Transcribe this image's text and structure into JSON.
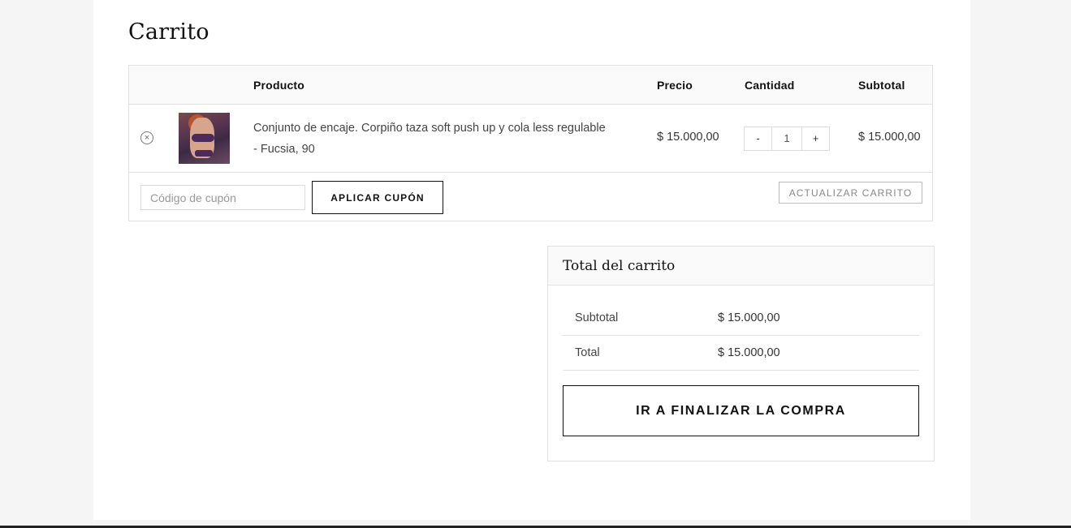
{
  "page_title": "Carrito",
  "table": {
    "headers": {
      "product": "Producto",
      "price": "Precio",
      "quantity": "Cantidad",
      "subtotal": "Subtotal"
    },
    "items": [
      {
        "name": "Conjunto de encaje. Corpiño taza soft push up y cola less regulable - Fucsia, 90",
        "price": "$ 15.000,00",
        "quantity": "1",
        "minus_label": "-",
        "plus_label": "+",
        "subtotal": "$ 15.000,00",
        "remove_icon": "×",
        "thumbnail_icon": "product-photo"
      }
    ]
  },
  "coupon": {
    "placeholder": "Código de cupón",
    "value": "",
    "apply_label": "APLICAR CUPÓN"
  },
  "update_cart_label": "ACTUALIZAR CARRITO",
  "totals": {
    "title": "Total del carrito",
    "subtotal_label": "Subtotal",
    "subtotal_value": "$ 15.000,00",
    "total_label": "Total",
    "total_value": "$ 15.000,00",
    "checkout_label": "IR A FINALIZAR LA COMPRA"
  },
  "colors": {
    "background": "#f5f5f5",
    "panel": "#ffffff",
    "header_bg": "#fafafa",
    "border": "#e2e2e2",
    "text": "#111111"
  }
}
